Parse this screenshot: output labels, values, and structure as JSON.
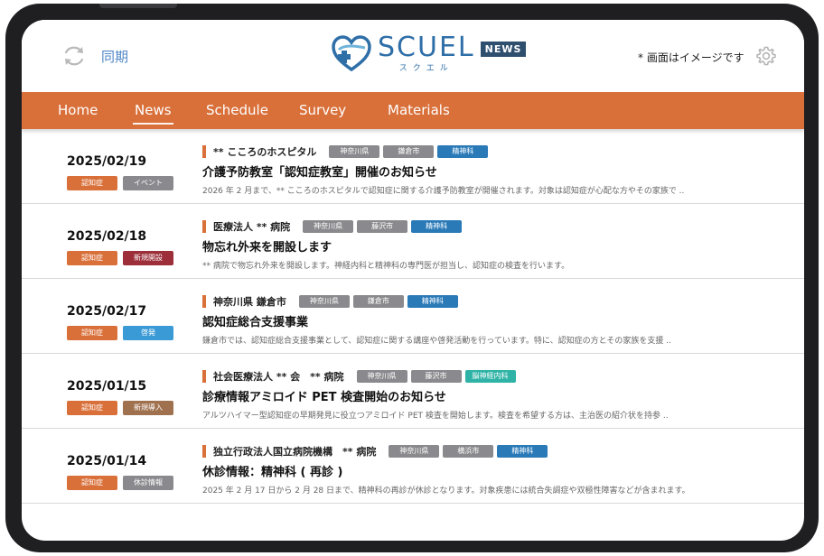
{
  "header": {
    "sync_label": "同期",
    "logo_main": "SCUEL",
    "logo_kana": "スクエル",
    "logo_badge": "NEWS",
    "note": "* 画面はイメージです",
    "accent": "#d9703a",
    "brand": "#2f6fa8"
  },
  "nav": {
    "items": [
      {
        "label": "Home"
      },
      {
        "label": "News"
      },
      {
        "label": "Schedule"
      },
      {
        "label": "Survey"
      },
      {
        "label": "Materials"
      }
    ],
    "active": "News"
  },
  "news": [
    {
      "date": "2025/02/19",
      "tags": [
        {
          "label": "認知症",
          "color": "#d9703a"
        },
        {
          "label": "イベント",
          "color": "#8a8a8e"
        }
      ],
      "source": "** こころのホスピタル",
      "chips": [
        {
          "label": "神奈川県",
          "style": "gray"
        },
        {
          "label": "鎌倉市",
          "style": "gray"
        },
        {
          "label": "精神科",
          "style": "blue"
        }
      ],
      "title": "介護予防教室「認知症教室」開催のお知らせ",
      "desc": "2026 年 2 月まで、** こころのホスピタルで認知症に関する介護予防教室が開催されます。対象は認知症が心配な方やその家族で .."
    },
    {
      "date": "2025/02/18",
      "tags": [
        {
          "label": "認知症",
          "color": "#d9703a"
        },
        {
          "label": "新規開設",
          "color": "#9c2f3a"
        }
      ],
      "source": "医療法人 ** 病院",
      "chips": [
        {
          "label": "神奈川県",
          "style": "gray"
        },
        {
          "label": "藤沢市",
          "style": "gray"
        },
        {
          "label": "精神科",
          "style": "blue"
        }
      ],
      "title": "物忘れ外来を開設します",
      "desc": "** 病院で物忘れ外来を開設します。神経内科と精神科の専門医が担当し、認知症の検査を行います。"
    },
    {
      "date": "2025/02/17",
      "tags": [
        {
          "label": "認知症",
          "color": "#d9703a"
        },
        {
          "label": "啓発",
          "color": "#3a9ad6"
        }
      ],
      "source": "神奈川県 鎌倉市",
      "chips": [
        {
          "label": "神奈川県",
          "style": "gray"
        },
        {
          "label": "鎌倉市",
          "style": "gray"
        },
        {
          "label": "精神科",
          "style": "blue"
        }
      ],
      "title": "認知症総合支援事業",
      "desc": "鎌倉市では、認知症総合支援事業として、認知症に関する講座や啓発活動を行っています。特に、認知症の方とその家族を支援 .."
    },
    {
      "date": "2025/01/15",
      "tags": [
        {
          "label": "認知症",
          "color": "#d9703a"
        },
        {
          "label": "新規導入",
          "color": "#a0714f"
        }
      ],
      "source": "社会医療法人 ** 会　** 病院",
      "chips": [
        {
          "label": "神奈川県",
          "style": "gray"
        },
        {
          "label": "藤沢市",
          "style": "gray"
        },
        {
          "label": "脳神経内科",
          "style": "teal"
        }
      ],
      "title": "診療情報アミロイド PET 検査開始のお知らせ",
      "desc": "アルツハイマー型認知症の早期発見に役立つアミロイド PET 検査を開始します。検査を希望する方は、主治医の紹介状を持参 .."
    },
    {
      "date": "2025/01/14",
      "tags": [
        {
          "label": "認知症",
          "color": "#d9703a"
        },
        {
          "label": "休診情報",
          "color": "#8a8a8e"
        }
      ],
      "source": "独立行政法人国立病院機構　** 病院",
      "chips": [
        {
          "label": "神奈川県",
          "style": "gray"
        },
        {
          "label": "横浜市",
          "style": "gray"
        },
        {
          "label": "精神科",
          "style": "blue"
        }
      ],
      "title": "休診情報：精神科 ( 再診 )",
      "desc": "2025 年 2 月 17 日から 2 月 28 日まで、精神科の再診が休診となります。対象疾患には統合失調症や双極性障害などが含まれます。"
    }
  ]
}
